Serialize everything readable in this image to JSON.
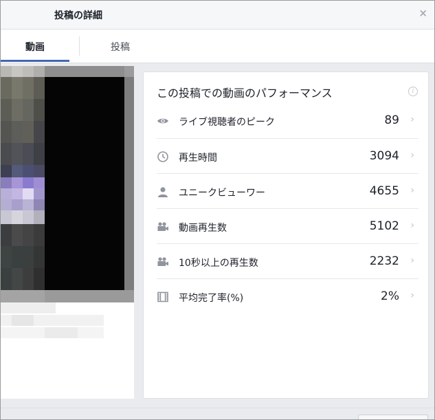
{
  "dialog": {
    "title": "投稿の詳細",
    "close_symbol": "×"
  },
  "tabs": [
    {
      "label": "動画",
      "active": true
    },
    {
      "label": "投稿",
      "active": false
    }
  ],
  "panel": {
    "title": "この投稿での動画のパフォーマンス",
    "info_symbol": "i"
  },
  "metrics": [
    {
      "label": "ライブ視聴者のピーク",
      "value": "89",
      "icon": "eye-icon"
    },
    {
      "label": "再生時間",
      "value": "3094",
      "icon": "clock-icon"
    },
    {
      "label": "ユニークビューワー",
      "value": "4655",
      "icon": "person-icon"
    },
    {
      "label": "動画再生数",
      "value": "5102",
      "icon": "video-camera-icon"
    },
    {
      "label": "10秒以上の再生数",
      "value": "2232",
      "icon": "video-camera-icon"
    },
    {
      "label": "平均完了率(%)",
      "value": "2%",
      "icon": "film-icon"
    }
  ],
  "chevron_symbol": "›",
  "colors": {
    "accent": "#4267b2",
    "icon_gray": "#90949c",
    "divider": "#dddfe2"
  }
}
